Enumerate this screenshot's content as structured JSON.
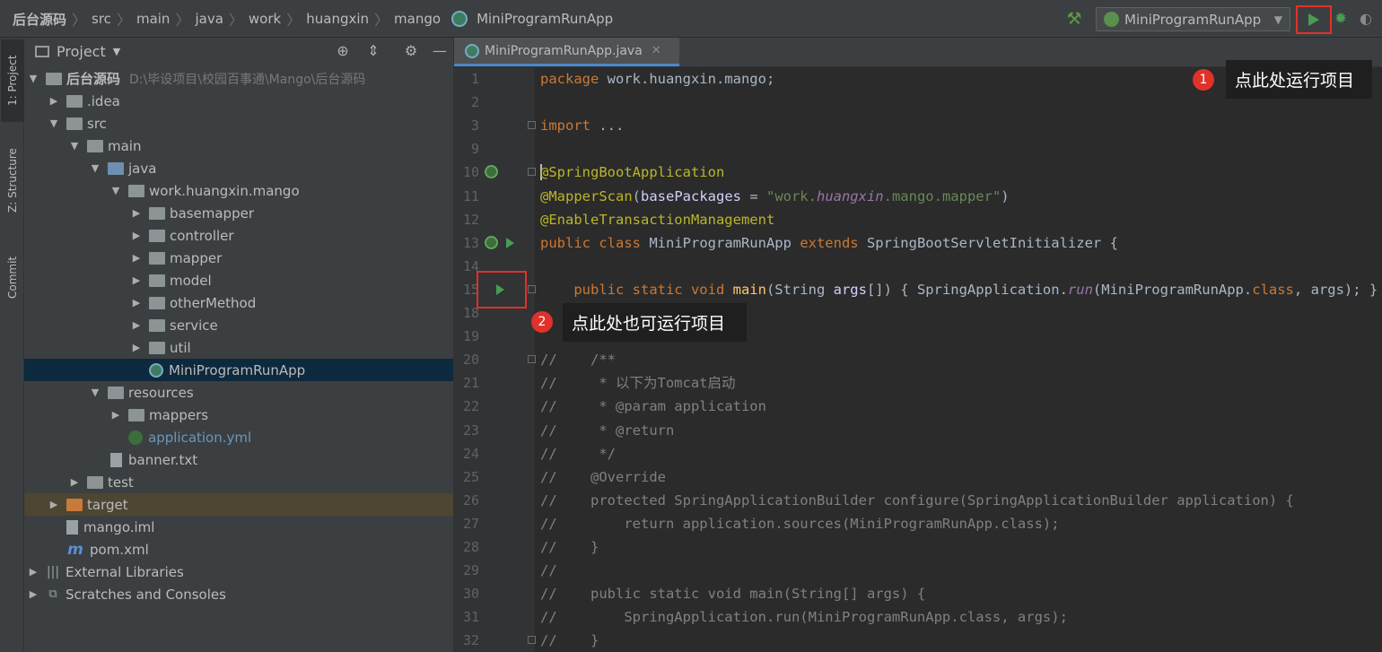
{
  "breadcrumb": [
    "后台源码",
    "src",
    "main",
    "java",
    "work",
    "huangxin",
    "mango",
    "MiniProgramRunApp"
  ],
  "toolbar": {
    "run_config": "MiniProgramRunApp"
  },
  "left_tabs": [
    "1: Project",
    "Z: Structure",
    "Commit"
  ],
  "project_panel": {
    "title": "Project",
    "tree": [
      {
        "label": "后台源码",
        "path": "D:\\毕设项目\\校园百事通\\Mango\\后台源码"
      },
      {
        "label": ".idea"
      },
      {
        "label": "src"
      },
      {
        "label": "main"
      },
      {
        "label": "java"
      },
      {
        "label": "work.huangxin.mango"
      },
      {
        "label": "basemapper"
      },
      {
        "label": "controller"
      },
      {
        "label": "mapper"
      },
      {
        "label": "model"
      },
      {
        "label": "otherMethod"
      },
      {
        "label": "service"
      },
      {
        "label": "util"
      },
      {
        "label": "MiniProgramRunApp"
      },
      {
        "label": "resources"
      },
      {
        "label": "mappers"
      },
      {
        "label": "application.yml"
      },
      {
        "label": "banner.txt"
      },
      {
        "label": "test"
      },
      {
        "label": "target"
      },
      {
        "label": "mango.iml"
      },
      {
        "label": "pom.xml"
      },
      {
        "label": "External Libraries"
      },
      {
        "label": "Scratches and Consoles"
      }
    ]
  },
  "editor": {
    "tab": "MiniProgramRunApp.java",
    "lines": [
      {
        "n": "1",
        "t": [
          [
            "kw",
            "package "
          ],
          [
            "",
            "work.huangxin.mango;"
          ]
        ]
      },
      {
        "n": "2",
        "t": []
      },
      {
        "n": "3",
        "t": [
          [
            "kw",
            "import "
          ],
          [
            "",
            "..."
          ]
        ]
      },
      {
        "n": "9",
        "t": []
      },
      {
        "n": "10",
        "t": [
          [
            "ann",
            "@SpringBootApplication"
          ]
        ]
      },
      {
        "n": "11",
        "t": [
          [
            "ann",
            "@MapperScan"
          ],
          [
            "",
            "("
          ],
          [
            "pm",
            "basePackages"
          ],
          [
            "",
            " = "
          ],
          [
            "str",
            "\"work."
          ],
          [
            "it",
            "huangxin"
          ],
          [
            "str",
            ".mango.mapper\""
          ],
          [
            "",
            ")"
          ]
        ]
      },
      {
        "n": "12",
        "t": [
          [
            "ann",
            "@EnableTransactionManagement"
          ]
        ]
      },
      {
        "n": "13",
        "t": [
          [
            "kw",
            "public class "
          ],
          [
            "",
            "MiniProgramRunApp "
          ],
          [
            "kw",
            "extends "
          ],
          [
            "",
            "SpringBootServletInitializer {"
          ]
        ]
      },
      {
        "n": "14",
        "t": []
      },
      {
        "n": "15",
        "t": [
          [
            "",
            "    "
          ],
          [
            "kw",
            "public static void "
          ],
          [
            "fn",
            "main"
          ],
          [
            "",
            "(String "
          ],
          [
            "pm",
            "args"
          ],
          [
            "",
            "[]) { SpringApplication."
          ],
          [
            "it",
            "run"
          ],
          [
            "",
            "(MiniProgramRunApp."
          ],
          [
            "kw",
            "class"
          ],
          [
            "",
            ", args); }"
          ]
        ]
      },
      {
        "n": "18",
        "t": []
      },
      {
        "n": "19",
        "t": []
      },
      {
        "n": "20",
        "t": [
          [
            "cmt",
            "//    /**"
          ]
        ]
      },
      {
        "n": "21",
        "t": [
          [
            "cmt",
            "//     * 以下为Tomcat启动"
          ]
        ]
      },
      {
        "n": "22",
        "t": [
          [
            "cmt",
            "//     * @param application"
          ]
        ]
      },
      {
        "n": "23",
        "t": [
          [
            "cmt",
            "//     * @return"
          ]
        ]
      },
      {
        "n": "24",
        "t": [
          [
            "cmt",
            "//     */"
          ]
        ]
      },
      {
        "n": "25",
        "t": [
          [
            "cmt",
            "//    @Override"
          ]
        ]
      },
      {
        "n": "26",
        "t": [
          [
            "cmt",
            "//    protected SpringApplicationBuilder configure(SpringApplicationBuilder application) {"
          ]
        ]
      },
      {
        "n": "27",
        "t": [
          [
            "cmt",
            "//        return application.sources(MiniProgramRunApp.class);"
          ]
        ]
      },
      {
        "n": "28",
        "t": [
          [
            "cmt",
            "//    }"
          ]
        ]
      },
      {
        "n": "29",
        "t": [
          [
            "cmt",
            "//"
          ]
        ]
      },
      {
        "n": "30",
        "t": [
          [
            "cmt",
            "//    public static void main(String[] args) {"
          ]
        ]
      },
      {
        "n": "31",
        "t": [
          [
            "cmt",
            "//        SpringApplication.run(MiniProgramRunApp.class, args);"
          ]
        ]
      },
      {
        "n": "32",
        "t": [
          [
            "cmt",
            "//    }"
          ]
        ]
      }
    ]
  },
  "callouts": [
    {
      "badge": "1",
      "text": "点此处运行项目"
    },
    {
      "badge": "2",
      "text": "点此处也可运行项目"
    }
  ],
  "colors": {
    "accent": "#4a88c7",
    "highlight_border": "#e0312b",
    "run_green": "#499c54"
  }
}
